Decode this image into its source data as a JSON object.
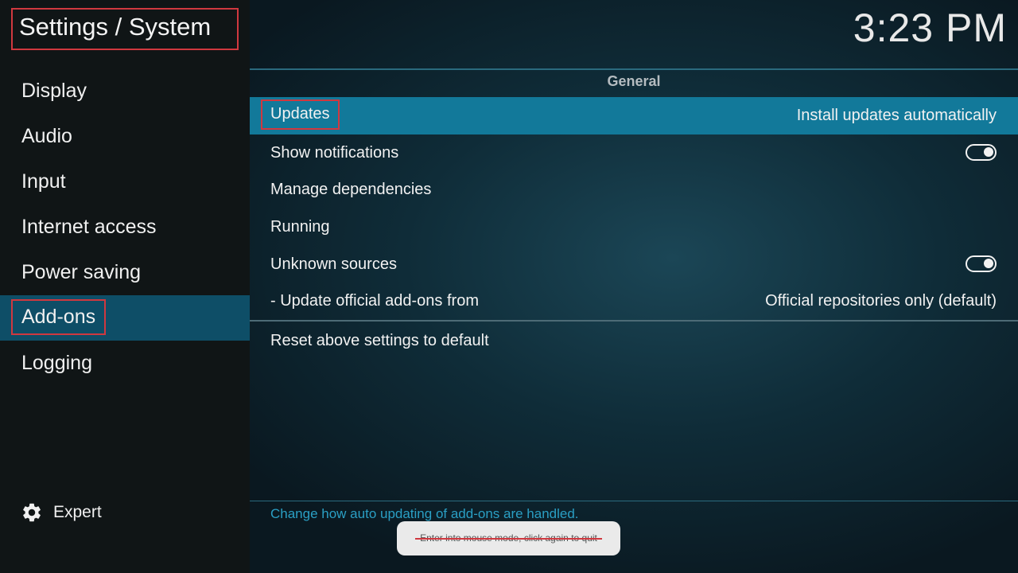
{
  "header": {
    "title": "Settings / System"
  },
  "clock": "3:23 PM",
  "sidebar": {
    "items": [
      {
        "label": "Display"
      },
      {
        "label": "Audio"
      },
      {
        "label": "Input"
      },
      {
        "label": "Internet access"
      },
      {
        "label": "Power saving"
      },
      {
        "label": "Add-ons",
        "active": true
      },
      {
        "label": "Logging"
      }
    ],
    "expert": {
      "label": "Expert",
      "icon": "gear-icon"
    }
  },
  "main": {
    "section_title": "General",
    "rows": [
      {
        "label": "Updates",
        "value": "Install updates automatically",
        "selected": true
      },
      {
        "label": "Show notifications",
        "toggle": "on"
      },
      {
        "label": "Manage dependencies"
      },
      {
        "label": "Running"
      },
      {
        "label": "Unknown sources",
        "toggle": "on"
      },
      {
        "label": "- Update official add-ons from",
        "value": "Official repositories only (default)"
      }
    ],
    "reset_label": "Reset above settings to default",
    "description": "Change how auto updating of add-ons are handled."
  },
  "toast": {
    "text": "Enter into mouse mode, click again to quit"
  },
  "colors": {
    "accent": "#12799a",
    "active_nav": "#0e4e67",
    "highlight_border": "#d0383f",
    "description": "#2a9fc4"
  }
}
